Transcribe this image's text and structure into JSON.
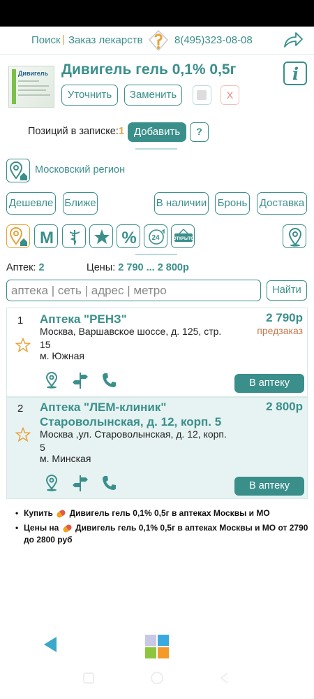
{
  "topbar": {
    "search": "Поиск",
    "separator": "|",
    "order": "Заказ лекарств",
    "phone": "8(495)323-08-08"
  },
  "product": {
    "title": "Дивигель гель 0,1% 0,5г",
    "image_brand": "Дивигель"
  },
  "actions": {
    "refine": "Уточнить",
    "replace": "Заменить",
    "remove": "X"
  },
  "note": {
    "positions_label": "Позиций в записке:",
    "positions_count": "1",
    "add": "Добавить",
    "help": "?"
  },
  "region": {
    "label": "Московский регион"
  },
  "filters": {
    "cheaper": "Дешевле",
    "closer": "Ближе",
    "in_stock": "В наличии",
    "reserve": "Бронь",
    "delivery": "Доставка"
  },
  "icon_filters": {
    "metro_letter": "M",
    "percent": "%",
    "hours": "24",
    "open": "ОТКРЫТО"
  },
  "stats": {
    "pharmacies_label": "Аптек:",
    "pharmacies_count": "2",
    "prices_label": "Цены:",
    "prices_range": "2 790 ... 2 800р"
  },
  "search": {
    "placeholder": "аптека | сеть | адрес | метро",
    "button": "Найти"
  },
  "results": [
    {
      "index": "1",
      "name": "Аптека \"РЕНЗ\"",
      "price": "2 790р",
      "status": "предзаказ",
      "address": "Москва, Варшавское шоссе, д. 125, стр. 15",
      "metro": "м. Южная",
      "button": "В аптеку"
    },
    {
      "index": "2",
      "name": "Аптека \"ЛЕМ-клиник\" Староволынская, д. 12, корп. 5",
      "price": "2 800р",
      "address": "Москва ,ул. Староволынская, д. 12, корп. 5",
      "metro": "м. Минская",
      "button": "В аптеку"
    }
  ],
  "links": {
    "buy_prefix": "Купить",
    "buy_text": "Дивигель гель 0,1% 0,5г в аптеках Москвы и МО",
    "price_prefix": "Цены на",
    "price_text": "Дивигель гель 0,1% 0,5г в аптеках Москвы и МО от 2790 до 2800 руб"
  },
  "colors": {
    "accent": "#3a8f8b",
    "highlight": "#e8a23a",
    "preorder": "#c5774a",
    "card_alt_bg": "#e6f3f2"
  }
}
